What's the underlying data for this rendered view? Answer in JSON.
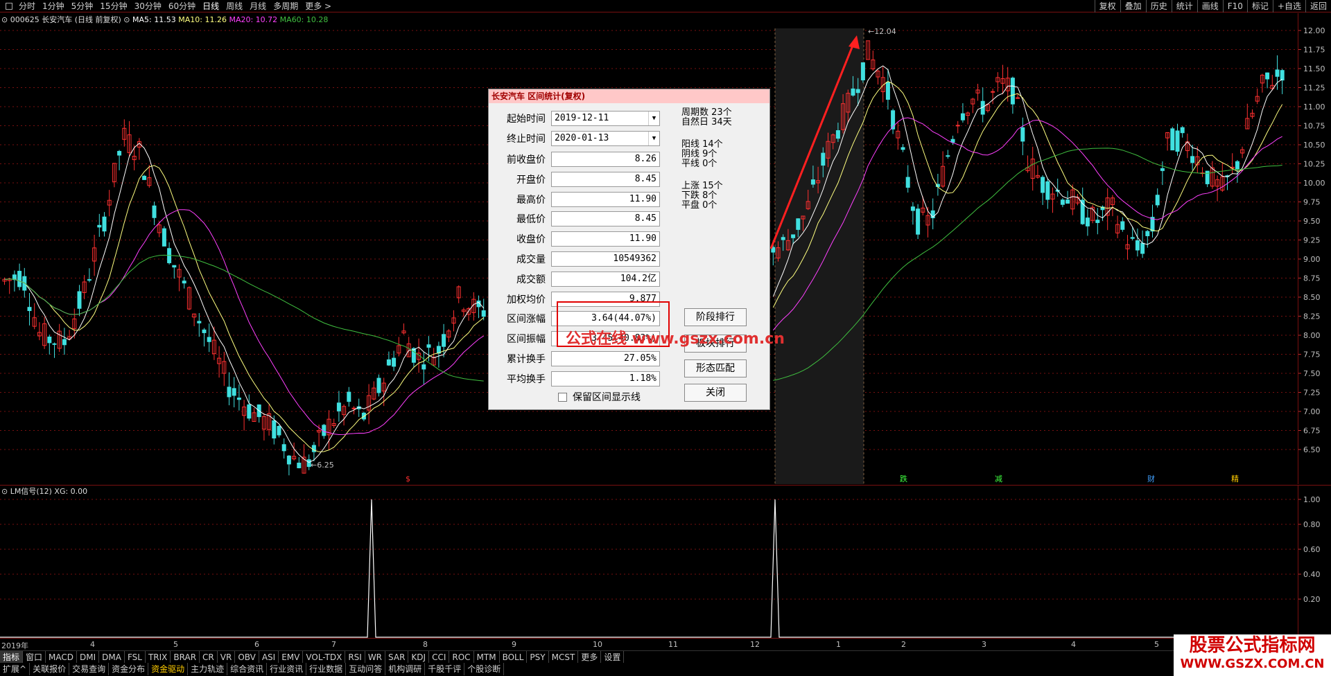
{
  "periods": [
    "分时",
    "1分钟",
    "5分钟",
    "15分钟",
    "30分钟",
    "60分钟",
    "日线",
    "周线",
    "月线",
    "多周期",
    "更多 >"
  ],
  "active_period": "日线",
  "right_buttons": [
    "复权",
    "叠加",
    "历史",
    "统计",
    "画线",
    "F10",
    "标记",
    "+自选",
    "返回"
  ],
  "legend": {
    "code_name": "000625 长安汽车 (日线 前复权)",
    "ma5": "MA5: 11.53",
    "ma10": "MA10: 11.26",
    "ma20": "MA20: 10.72",
    "ma60": "MA60: 10.28"
  },
  "colors": {
    "up": "#ff3030",
    "down": "#40e0e0",
    "ma5": "#ffffff",
    "ma10": "#ffff80",
    "ma20": "#ff40ff",
    "ma60": "#40c040",
    "grid": "#7a1010"
  },
  "y_labels": [
    "12.00",
    "11.75",
    "11.50",
    "11.25",
    "11.00",
    "10.75",
    "10.50",
    "10.25",
    "10.00",
    "9.75",
    "9.50",
    "9.25",
    "9.00",
    "8.75",
    "8.50",
    "8.25",
    "8.00",
    "7.75",
    "7.50",
    "7.25",
    "7.00",
    "6.75",
    "6.50"
  ],
  "sub_y_labels": [
    "1.00",
    "0.80",
    "0.60",
    "0.40",
    "0.20"
  ],
  "annotations": {
    "low": "6.25",
    "high": "12.04"
  },
  "markers": [
    {
      "label": "$",
      "color": "#ff3030"
    },
    {
      "label": "跌",
      "color": "#40ff40"
    },
    {
      "label": "减",
      "color": "#40ff40"
    },
    {
      "label": "财",
      "color": "#40a0ff"
    },
    {
      "label": "精",
      "color": "#ffcc00"
    }
  ],
  "sub_legend": "LM信号(12) XG: 0.00",
  "x_labels": [
    "2019年",
    "4",
    "5",
    "6",
    "7",
    "8",
    "9",
    "10",
    "11",
    "12",
    "1",
    "2",
    "3",
    "4",
    "5"
  ],
  "tabs1": [
    "指标",
    "窗口",
    "MACD",
    "DMI",
    "DMA",
    "FSL",
    "TRIX",
    "BRAR",
    "CR",
    "VR",
    "OBV",
    "ASI",
    "EMV",
    "VOL-TDX",
    "RSI",
    "WR",
    "SAR",
    "KDJ",
    "CCI",
    "ROC",
    "MTM",
    "BOLL",
    "PSY",
    "MCST",
    "更多",
    "设置"
  ],
  "tabs2": [
    "扩展^",
    "关联报价",
    "交易查询",
    "资金分布",
    "资金驱动",
    "主力轨迹",
    "综合资讯",
    "行业资讯",
    "行业数据",
    "互动问答",
    "机构调研",
    "千股千评",
    "个股诊断"
  ],
  "dialog": {
    "title": "长安汽车 区间统计(复权)",
    "start_label": "起始时间",
    "start": "2019-12-11",
    "end_label": "终止时间",
    "end": "2020-01-13",
    "fields": [
      {
        "label": "前收盘价",
        "value": "8.26"
      },
      {
        "label": "开盘价",
        "value": "8.45"
      },
      {
        "label": "最高价",
        "value": "11.90"
      },
      {
        "label": "最低价",
        "value": "8.45"
      },
      {
        "label": "收盘价",
        "value": "11.90"
      },
      {
        "label": "成交量",
        "value": "10549362"
      },
      {
        "label": "成交额",
        "value": "104.2亿"
      },
      {
        "label": "加权均价",
        "value": "9.877"
      },
      {
        "label": "区间涨幅",
        "value": "3.64(44.07%)"
      },
      {
        "label": "区间振幅",
        "value": "3.45(40.83%)"
      },
      {
        "label": "累计换手",
        "value": "27.05%"
      },
      {
        "label": "平均换手",
        "value": "1.18%"
      }
    ],
    "stats": {
      "periods": "周期数  23个",
      "natural_days": "自然日  34天",
      "yang": "阳线  14个",
      "yin": "阴线  9个",
      "flat": "平线  0个",
      "rise": "上涨  15个",
      "fall": "下跌  8个",
      "level": "平盘  0个"
    },
    "buttons": {
      "stage_rank": "阶段排行",
      "sector_rank": "板块排行",
      "pattern": "形态匹配",
      "close": "关闭"
    },
    "keep_lines": "保留区间显示线"
  },
  "watermark": "公式在线  www.gszx.com.cn",
  "logo": {
    "line1": "股票公式指标网",
    "line2": "WWW.GSZX.COM.CN"
  }
}
